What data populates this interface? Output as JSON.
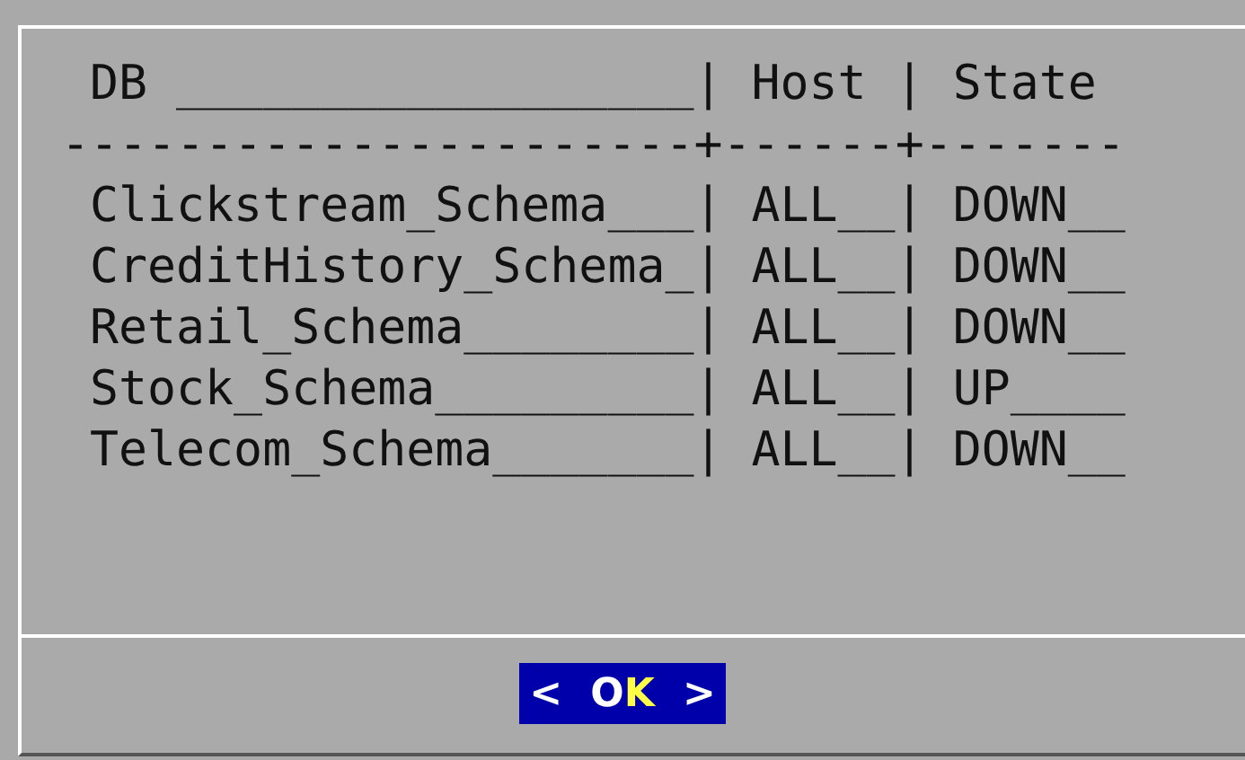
{
  "table": {
    "header": "DB __________________| Host | State",
    "divider": "----------------------+------+-------",
    "rows": [
      "Clickstream_Schema___| ALL__| DOWN__",
      "CreditHistory_Schema_| ALL__| DOWN__",
      "Retail_Schema________| ALL__| DOWN__",
      "Stock_Schema_________| ALL__| UP____",
      "Telecom_Schema_______| ALL__| DOWN__"
    ]
  },
  "button": {
    "left_mark": "<",
    "label": "O",
    "hotkey": "K",
    "right_mark": ">",
    "selected": true
  }
}
